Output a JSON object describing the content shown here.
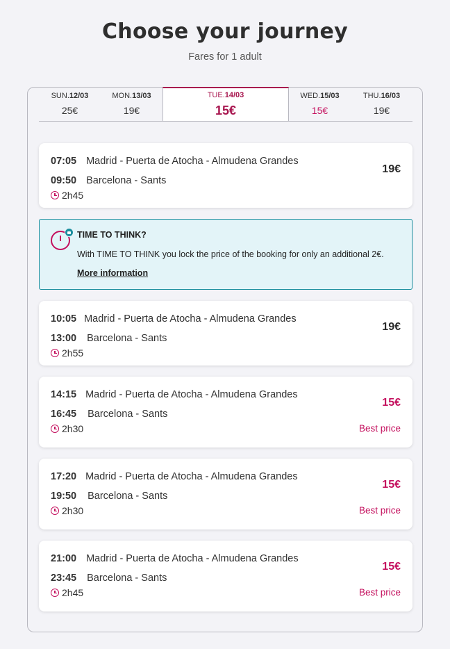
{
  "header": {
    "title": "Choose your journey",
    "subtitle": "Fares for 1 adult"
  },
  "dates": [
    {
      "label_day": "SUN.",
      "label_date": "12/03",
      "price": "25€",
      "state": "normal"
    },
    {
      "label_day": "MON.",
      "label_date": "13/03",
      "price": "19€",
      "state": "normal"
    },
    {
      "label_day": "TUE.",
      "label_date": "14/03",
      "price": "15€",
      "state": "selected"
    },
    {
      "label_day": "WED.",
      "label_date": "15/03",
      "price": "15€",
      "state": "pink"
    },
    {
      "label_day": "THU.",
      "label_date": "16/03",
      "price": "19€",
      "state": "normal"
    }
  ],
  "trips": [
    {
      "depart": "07:05",
      "from": "Madrid - Puerta de Atocha - Almudena Grandes",
      "arrive": "09:50",
      "to": "Barcelona - Sants",
      "duration": "2h45",
      "price": "19€",
      "badge": ""
    },
    {
      "depart": "10:05",
      "from": "Madrid - Puerta de Atocha - Almudena Grandes",
      "arrive": "13:00",
      "to": "Barcelona - Sants",
      "duration": "2h55",
      "price": "19€",
      "badge": ""
    },
    {
      "depart": "14:15",
      "from": "Madrid - Puerta de Atocha - Almudena Grandes",
      "arrive": "16:45",
      "to": "Barcelona - Sants",
      "duration": "2h30",
      "price": "15€",
      "badge": "Best price"
    },
    {
      "depart": "17:20",
      "from": "Madrid - Puerta de Atocha - Almudena Grandes",
      "arrive": "19:50",
      "to": "Barcelona - Sants",
      "duration": "2h30",
      "price": "15€",
      "badge": "Best price"
    },
    {
      "depart": "21:00",
      "from": "Madrid - Puerta de Atocha - Almudena Grandes",
      "arrive": "23:45",
      "to": "Barcelona - Sants",
      "duration": "2h45",
      "price": "15€",
      "badge": "Best price"
    }
  ],
  "promo": {
    "title": "TIME TO THINK?",
    "text": "With TIME TO THINK you lock the price of the booking for only an additional 2€.",
    "link": "More information",
    "icon": "clock-lock-icon"
  },
  "colors": {
    "accent": "#c4105e",
    "promo_bg": "#e3f4f8",
    "promo_border": "#1a8e9e"
  }
}
